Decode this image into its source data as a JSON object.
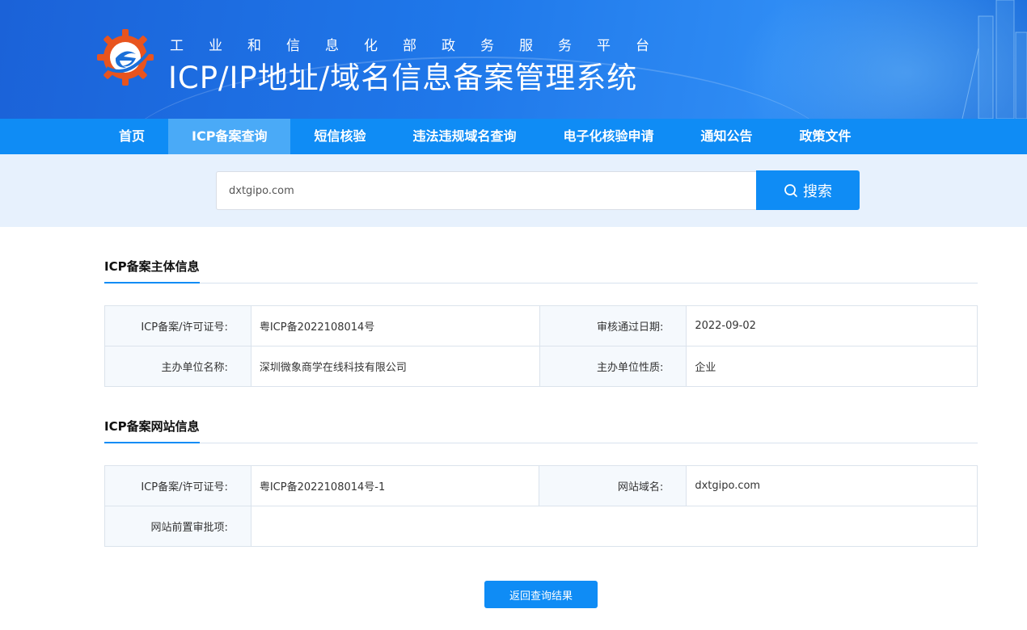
{
  "header": {
    "subtitle": "工业和信息化部政务服务平台",
    "title": "ICP/IP地址/域名信息备案管理系统"
  },
  "nav": {
    "items": [
      {
        "label": "首页"
      },
      {
        "label": "ICP备案查询"
      },
      {
        "label": "短信核验"
      },
      {
        "label": "违法违规域名查询"
      },
      {
        "label": "电子化核验申请"
      },
      {
        "label": "通知公告"
      },
      {
        "label": "政策文件"
      }
    ],
    "active_index": 1
  },
  "search": {
    "value": "dxtgipo.com",
    "button_label": "搜索"
  },
  "subject_section": {
    "title": "ICP备案主体信息",
    "rows": [
      {
        "label1": "ICP备案/许可证号:",
        "value1": "粤ICP备2022108014号",
        "label2": "审核通过日期:",
        "value2": "2022-09-02"
      },
      {
        "label1": "主办单位名称:",
        "value1": "深圳微象商学在线科技有限公司",
        "label2": "主办单位性质:",
        "value2": "企业"
      }
    ]
  },
  "website_section": {
    "title": "ICP备案网站信息",
    "row1": {
      "label1": "ICP备案/许可证号:",
      "value1": "粤ICP备2022108014号-1",
      "label2": "网站域名:",
      "value2": "dxtgipo.com"
    },
    "row2": {
      "label1": "网站前置审批项:",
      "value1": ""
    }
  },
  "back_button": "返回查询结果",
  "colors": {
    "primary": "#0f8cf5",
    "nav_active": "#4aaaf7",
    "search_band": "#e7f1fd"
  }
}
